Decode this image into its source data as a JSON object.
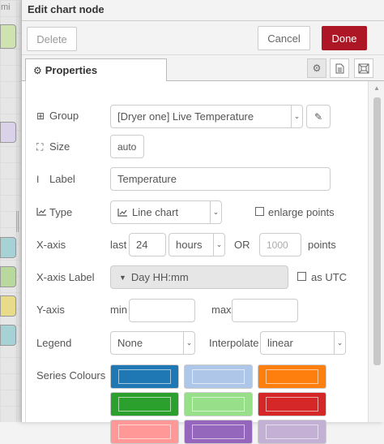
{
  "background": {
    "fragment_text": "mi"
  },
  "dialog": {
    "title": "Edit chart node",
    "buttons": {
      "delete": "Delete",
      "cancel": "Cancel",
      "done": "Done"
    },
    "tabs": [
      {
        "label": "Properties",
        "icon": "gear-icon"
      }
    ],
    "tab_icons": [
      "gear-icon",
      "document-icon",
      "frame-icon"
    ]
  },
  "form": {
    "group": {
      "label": "Group",
      "icon": "table-icon",
      "value": "[Dryer one] Live Temperature",
      "edit_icon": "pencil-icon"
    },
    "size": {
      "label": "Size",
      "icon": "resize-icon",
      "value": "auto"
    },
    "label": {
      "label": "Label",
      "icon": "text-cursor-icon",
      "value": "Temperature"
    },
    "type": {
      "label": "Type",
      "icon": "line-chart-icon",
      "value": "Line chart",
      "enlarge_points_label": "enlarge points",
      "enlarge_points_checked": false
    },
    "xaxis": {
      "label": "X-axis",
      "last_label": "last",
      "last_value": "24",
      "unit_value": "hours",
      "or_label": "OR",
      "points_placeholder": "1000",
      "points_label": "points"
    },
    "xaxis_label": {
      "label": "X-axis Label",
      "value": "Day HH:mm",
      "as_utc_label": "as UTC",
      "as_utc_checked": false
    },
    "yaxis": {
      "label": "Y-axis",
      "min_label": "min",
      "min_value": "",
      "max_label": "max",
      "max_value": ""
    },
    "legend": {
      "label": "Legend",
      "value": "None",
      "interpolate_label": "Interpolate",
      "interpolate_value": "linear"
    },
    "series_colours": {
      "label": "Series Colours",
      "colors": [
        "#1f77b4",
        "#aec7e8",
        "#ff7f0e",
        "#2ca02c",
        "#98df8a",
        "#d62728",
        "#ff9896",
        "#9467bd",
        "#c5b0d5"
      ]
    }
  }
}
